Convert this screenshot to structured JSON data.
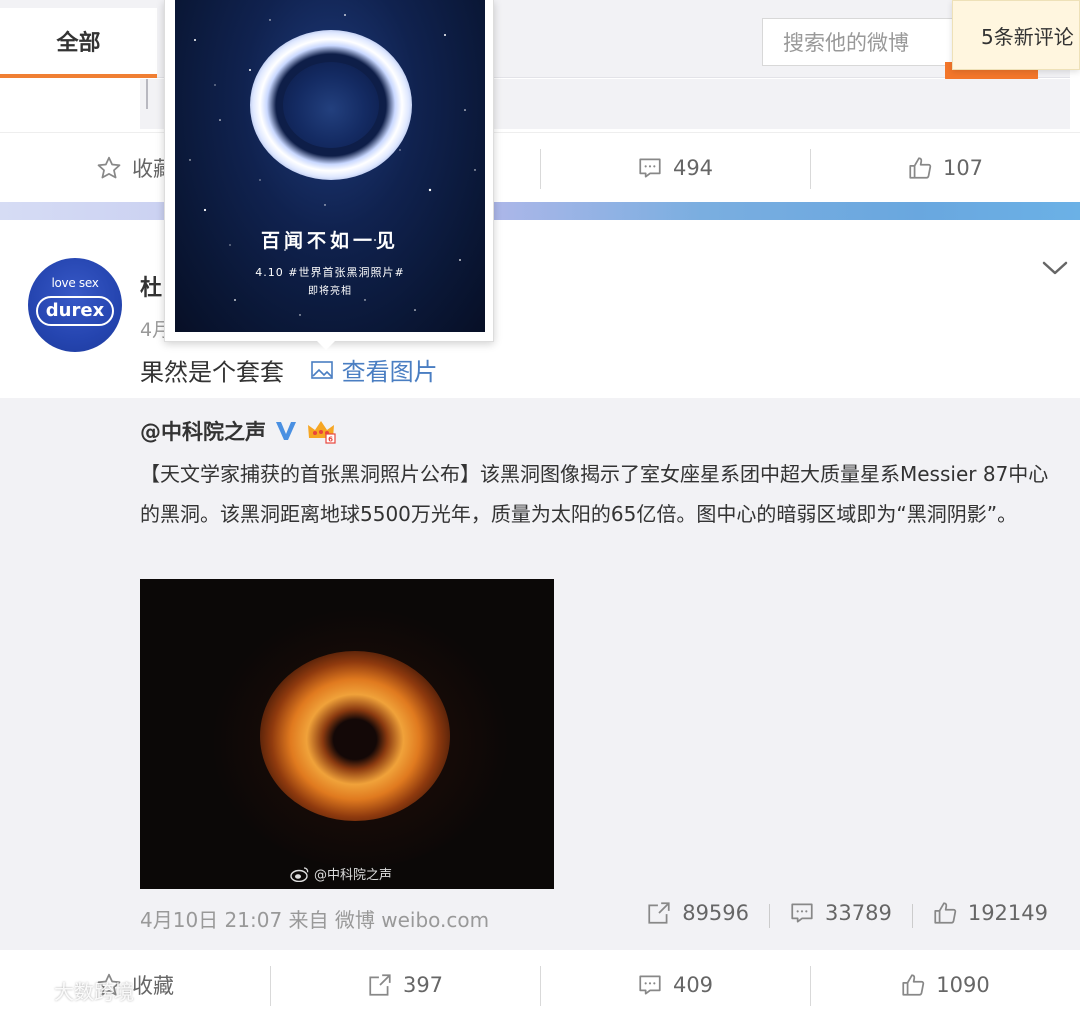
{
  "header": {
    "tab_all": "全部",
    "search_placeholder": "搜索他的微博",
    "new_comments": "5条新评论"
  },
  "post1_actions": {
    "favorite": "收藏",
    "comments": "494",
    "likes": "107"
  },
  "popup": {
    "title": "百闻不如一见",
    "subtitle": "4.10 #世界首张黑洞照片#",
    "subtitle2": "即将亮相"
  },
  "post2": {
    "user_name": "杜",
    "date": "4月",
    "text": "果然是个套套",
    "view_image": "查看图片",
    "avatar_top": "love sex",
    "avatar_brand": "durex"
  },
  "repost": {
    "user": "@中科院之声",
    "text": "【天文学家捕获的首张黑洞照片公布】该黑洞图像揭示了室女座星系团中超大质量星系Messier 87中心的黑洞。该黑洞距离地球5500万光年，质量为太阳的65亿倍。图中心的暗弱区域即为“黑洞阴影”。",
    "image_watermark": "@中科院之声",
    "meta": "4月10日 21:07 来自 微博 weibo.com",
    "reposts": "89596",
    "comments": "33789",
    "likes": "192149"
  },
  "post2_actions": {
    "favorite": "收藏",
    "reposts": "397",
    "comments": "409",
    "likes": "1090"
  },
  "watermark": "大数跨境",
  "icons": {
    "favorite": "star-icon",
    "comment": "comment-icon",
    "like": "thumbs-up-icon",
    "repost": "repost-icon",
    "image": "image-icon",
    "chevron": "chevron-down-icon"
  },
  "colors": {
    "accent_orange": "#f07f33",
    "link_blue": "#4a7ec2",
    "verified_blue": "#4a90e2"
  }
}
